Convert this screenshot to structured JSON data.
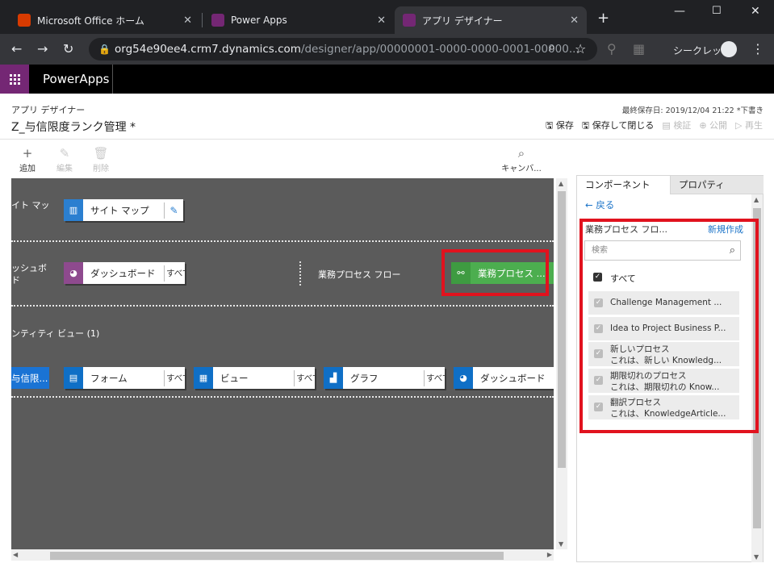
{
  "browser": {
    "tabs": [
      {
        "title": "Microsoft Office ホーム",
        "icon": "office-icon",
        "color": "#d83b01"
      },
      {
        "title": "Power Apps",
        "icon": "powerapps-icon",
        "color": "#742774"
      },
      {
        "title": "アプリ デザイナー",
        "icon": "powerapps-icon",
        "color": "#742774"
      }
    ],
    "url_main": "org54e90ee4.crm7.dynamics.com",
    "url_path": "/designer/app/00000001-0000-0000-0001-00000...",
    "incognito_label": "シークレット"
  },
  "header": {
    "app_name": "PowerApps",
    "brand_color": "#742774"
  },
  "designer": {
    "subtitle": "アプリ デザイナー",
    "title": "Z_与信限度ランク管理 *",
    "last_saved": "最終保存日: 2019/12/04 21:22 *下書き",
    "actions": [
      {
        "label": "保存",
        "enabled": true
      },
      {
        "label": "保存して閉じる",
        "enabled": true
      },
      {
        "label": "検証",
        "enabled": false
      },
      {
        "label": "公開",
        "enabled": false
      },
      {
        "label": "再生",
        "enabled": false
      }
    ]
  },
  "toolbar": {
    "add": "追加",
    "edit": "編集",
    "delete": "削除",
    "canvas": "キャンバ..."
  },
  "canvas": {
    "sitemap_label": "イト マッ",
    "sitemap_card": "サイト マップ",
    "dashboard_label_1": "ッシュボ",
    "dashboard_label_2": "ド",
    "dashboard_card": "ダッシュボード",
    "all": "すべて",
    "bpf_label": "業務プロセス フロー",
    "bpf_card": "業務プロセス ...",
    "entity_view_label": "ンティティ ビュー (1)",
    "entity_card": "与信限...",
    "form_card": "フォーム",
    "view_card": "ビュー",
    "chart_card": "グラフ",
    "dashboard_card_2": "ダッシュボード"
  },
  "panel": {
    "tab_components": "コンポーネント",
    "tab_properties": "プロパティ",
    "back": "戻る",
    "bpf_header": "業務プロセス フロ...",
    "new": "新規作成",
    "search_placeholder": "検索",
    "all_label": "すべて",
    "items": [
      {
        "name": "Challenge Management ...",
        "desc": "",
        "checked": true
      },
      {
        "name": "Idea to Project Business P...",
        "desc": "",
        "checked": true
      },
      {
        "name": "新しいプロセス",
        "desc": "これは、新しい Knowledg...",
        "checked": true
      },
      {
        "name": "期限切れのプロセス",
        "desc": "これは、期限切れの Know...",
        "checked": true
      },
      {
        "name": "翻訳プロセス",
        "desc": "これは、KnowledgeArticle...",
        "checked": true
      }
    ]
  },
  "colors": {
    "highlight": "#e1121e",
    "bpf_green": "#3fae49",
    "blue": "#0078d4",
    "purple": "#8e4a8e"
  }
}
